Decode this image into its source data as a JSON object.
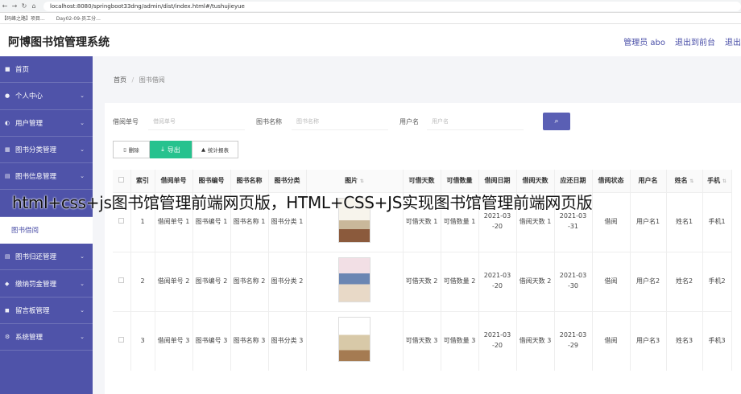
{
  "browser": {
    "url": "localhost:8080/springboot33dng/admin/dist/index.html#/tushujieyue",
    "bookmarks": [
      "【码峰之路】项目...",
      "Day02-09-员工分..."
    ]
  },
  "header": {
    "title": "阿博图书馆管理系统",
    "admin_label": "管理员 abo",
    "back_label": "退出到前台",
    "logout_label": "退出"
  },
  "sidebar": {
    "items": [
      {
        "label": "首页",
        "icon": "home-icon",
        "chevron": false
      },
      {
        "label": "个人中心",
        "icon": "user-icon",
        "chevron": true
      },
      {
        "label": "用户管理",
        "icon": "users-icon",
        "chevron": true
      },
      {
        "label": "图书分类管理",
        "icon": "grid-icon",
        "chevron": true
      },
      {
        "label": "图书信息管理",
        "icon": "book-icon",
        "chevron": true
      },
      {
        "label": "",
        "icon": "",
        "chevron": false
      },
      {
        "label": "图书借阅",
        "icon": "",
        "chevron": false,
        "sub": true
      },
      {
        "label": "图书归还管理",
        "icon": "return-icon",
        "chevron": true
      },
      {
        "label": "缴纳罚金管理",
        "icon": "money-icon",
        "chevron": true
      },
      {
        "label": "留言板管理",
        "icon": "message-icon",
        "chevron": true
      },
      {
        "label": "系统管理",
        "icon": "gear-icon",
        "chevron": true
      }
    ]
  },
  "breadcrumb": {
    "home": "首页",
    "sep": "/",
    "current": "图书借阅"
  },
  "search": {
    "f1_label": "借阅单号",
    "f1_placeholder": "借阅单号",
    "f2_label": "图书名称",
    "f2_placeholder": "图书名称",
    "f3_label": "用户名",
    "f3_placeholder": "用户名",
    "search_icon": "search-icon"
  },
  "actions": {
    "delete": "删除",
    "export": "导出",
    "stats": "统计报表"
  },
  "table": {
    "headers": [
      "",
      "索引",
      "借阅单号",
      "图书编号",
      "图书名称",
      "图书分类",
      "图片",
      "可借天数",
      "可借数量",
      "借阅日期",
      "借阅天数",
      "应还日期",
      "借阅状态",
      "用户名",
      "姓名",
      "手机"
    ],
    "rows": [
      {
        "index": "1",
        "c1": "借阅单号 1",
        "c2": "图书编号 1",
        "c3": "图书名称 1",
        "c4": "图书分类 1",
        "c7": "可借天数 1",
        "c8": "可借数量 1",
        "c9": "2021-03 -20",
        "c10": "借阅天数 1",
        "c11": "2021-03 -31",
        "c12": "借阅",
        "c13": "用户名1",
        "c14": "姓名1",
        "c15": "手机1"
      },
      {
        "index": "2",
        "c1": "借阅单号 2",
        "c2": "图书编号 2",
        "c3": "图书名称 2",
        "c4": "图书分类 2",
        "c7": "可借天数 2",
        "c8": "可借数量 2",
        "c9": "2021-03 -20",
        "c10": "借阅天数 2",
        "c11": "2021-03 -30",
        "c12": "借阅",
        "c13": "用户名2",
        "c14": "姓名2",
        "c15": "手机2"
      },
      {
        "index": "3",
        "c1": "借阅单号 3",
        "c2": "图书编号 3",
        "c3": "图书名称 3",
        "c4": "图书分类 3",
        "c7": "可借天数 3",
        "c8": "可借数量 3",
        "c9": "2021-03 -20",
        "c10": "借阅天数 3",
        "c11": "2021-03 -29",
        "c12": "借阅",
        "c13": "用户名3",
        "c14": "姓名3",
        "c15": "手机3"
      }
    ]
  },
  "overlay_text": "html+css+js图书馆管理前端网页版，HTML+CSS+JS实现图书馆管理前端网页版",
  "colors": {
    "sidebar": "#4f53a9",
    "accent": "#5a5fb4",
    "export": "#26c28e"
  }
}
